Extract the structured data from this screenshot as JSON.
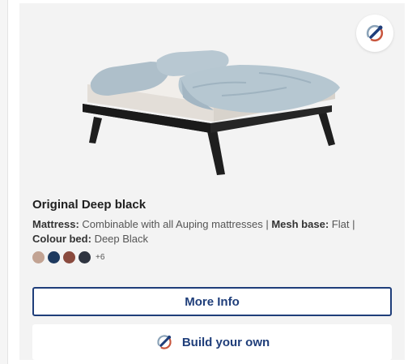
{
  "product": {
    "title": "Original Deep black",
    "specs": {
      "mattress_label": "Mattress:",
      "mattress_value": "Combinable with all Auping mattresses",
      "separator": "|",
      "mesh_label": "Mesh base:",
      "mesh_value": "Flat",
      "colour_label": "Colour bed:",
      "colour_value": "Deep Black"
    },
    "swatches": [
      {
        "name": "beige",
        "color": "#c2a393"
      },
      {
        "name": "navy",
        "color": "#1e3a5f"
      },
      {
        "name": "brown",
        "color": "#8a4a3e"
      },
      {
        "name": "dark-grey",
        "color": "#2e3440"
      }
    ],
    "more_colours": "+6"
  },
  "actions": {
    "more_info_label": "More Info",
    "build_label": "Build your own"
  },
  "icons": {
    "configurator": "configurator-brush-icon"
  },
  "colors": {
    "accent": "#1f3e7a",
    "card_bg": "#f3f3f3"
  }
}
